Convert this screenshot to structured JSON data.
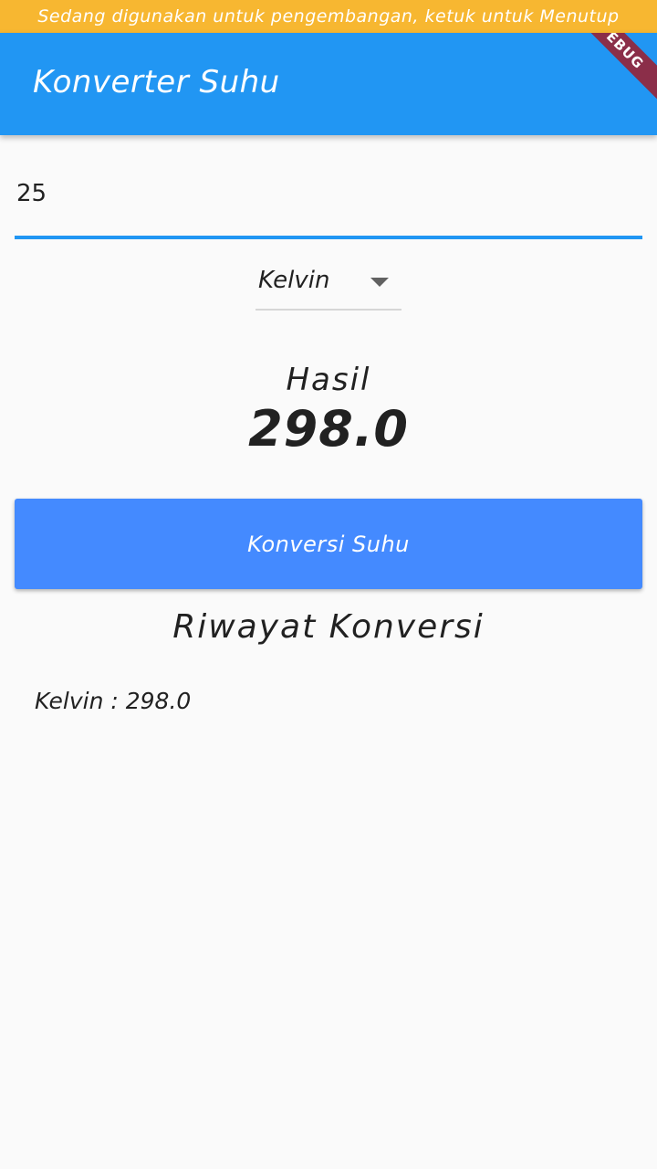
{
  "banner": {
    "text": "Sedang digunakan untuk pengembangan, ketuk untuk Menutup"
  },
  "app_bar": {
    "title": "Konverter Suhu",
    "debug_ribbon": "EBUG"
  },
  "input": {
    "value": "25",
    "accent_color": "#2196f3"
  },
  "dropdown": {
    "selected": "Kelvin"
  },
  "result": {
    "label": "Hasil",
    "value": "298.0"
  },
  "button": {
    "label": "Konversi Suhu",
    "color": "#448aff"
  },
  "history": {
    "title": "Riwayat Konversi",
    "items": [
      {
        "text": "Kelvin : 298.0"
      }
    ]
  },
  "colors": {
    "banner": "#f7b731",
    "app_bar": "#2196f3",
    "background": "#fafafa"
  }
}
